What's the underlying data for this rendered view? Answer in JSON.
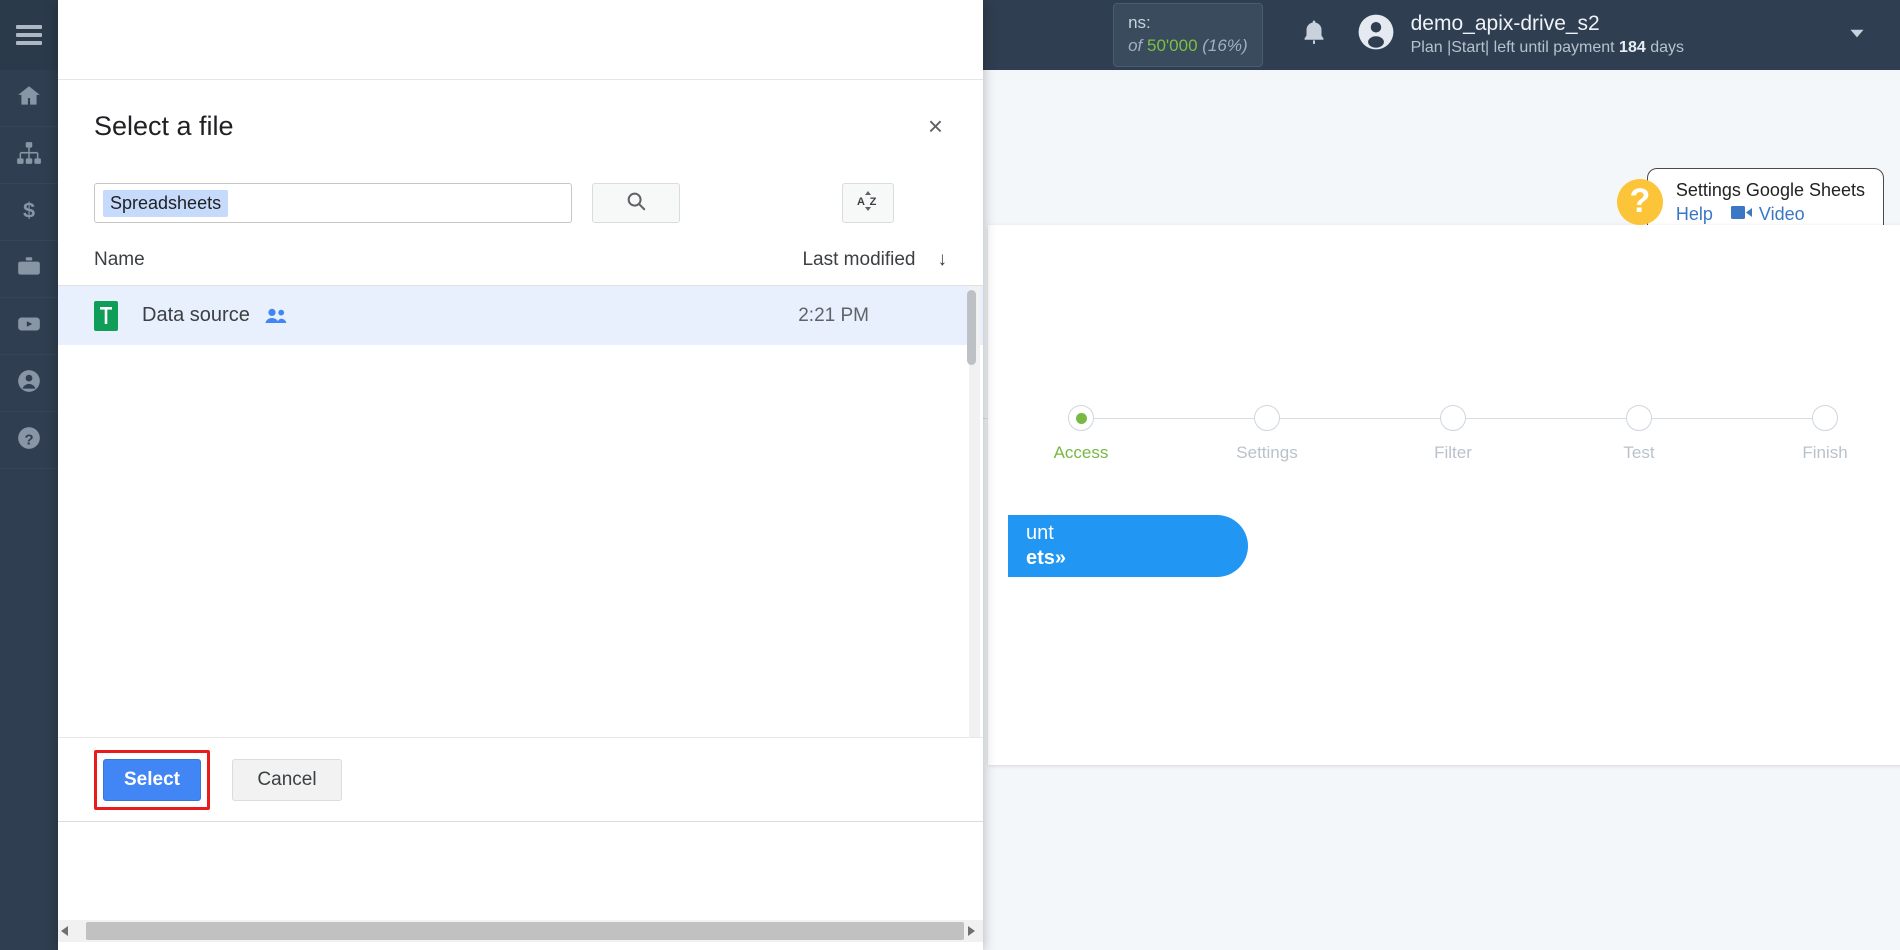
{
  "sidebar": {
    "menu_toggle": "menu-toggle",
    "items": [
      {
        "name": "home",
        "icon": "home-icon"
      },
      {
        "name": "connections",
        "icon": "sitemap-icon"
      },
      {
        "name": "billing",
        "icon": "dollar-icon"
      },
      {
        "name": "business",
        "icon": "briefcase-icon"
      },
      {
        "name": "video",
        "icon": "youtube-icon"
      },
      {
        "name": "profile",
        "icon": "user-icon"
      },
      {
        "name": "help",
        "icon": "question-icon"
      }
    ]
  },
  "topbar": {
    "quota_line1": "ns:",
    "quota_prefix": "of",
    "quota_value": "50'000",
    "quota_percent": "(16%)",
    "notifications_icon": "bell-icon",
    "account_name": "demo_apix-drive_s2",
    "account_plan_prefix": "Plan |Start| left until payment",
    "account_plan_days": "184",
    "account_plan_suffix": "days",
    "caret_icon": "chevron-down-icon"
  },
  "help_bubble": {
    "question_mark": "?",
    "title": "Settings Google Sheets",
    "help_link": "Help",
    "video_link": "Video",
    "video_icon": "video-camera-icon"
  },
  "wizard": {
    "steps": [
      {
        "label": "Access",
        "active": true
      },
      {
        "label": "Settings",
        "active": false
      },
      {
        "label": "Filter",
        "active": false
      },
      {
        "label": "Test",
        "active": false
      },
      {
        "label": "Finish",
        "active": false
      }
    ],
    "connect_button_line1": "unt",
    "connect_button_line2": "ets»"
  },
  "picker": {
    "title": "Select a file",
    "close_label": "×",
    "search_chip": "Spreadsheets",
    "search_icon": "search-icon",
    "sort_icon": "sort-az-icon",
    "columns": {
      "name": "Name",
      "last_modified": "Last modified",
      "sort_arrow": "↓"
    },
    "files": [
      {
        "icon": "google-sheets-icon",
        "name": "Data source",
        "shared_icon": "people-shared-icon",
        "last_modified": "2:21 PM",
        "selected": true
      }
    ],
    "select_label": "Select",
    "cancel_label": "Cancel"
  },
  "colors": {
    "accent_blue": "#4285f4",
    "sheets_green": "#0f9d58",
    "active_step_green": "#78b843",
    "highlight_red": "#e81c1c",
    "help_yellow": "#fcc438",
    "chip_blue": "#c6dafc",
    "row_selected": "#e8f0fe",
    "sidebar_dark": "#2f3e50"
  }
}
